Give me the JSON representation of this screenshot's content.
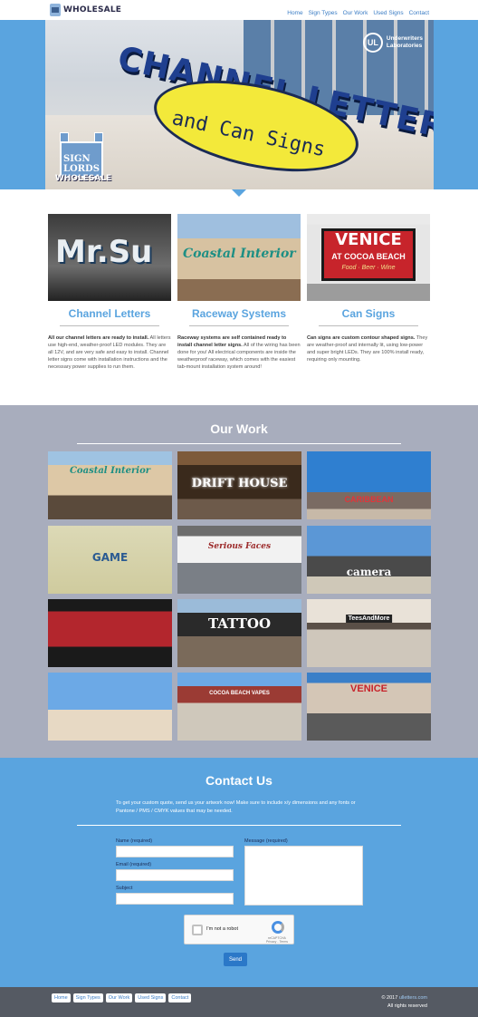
{
  "header": {
    "logo_text": "WHOLESALE",
    "nav": [
      "Home",
      "Sign Types",
      "Our Work",
      "Used Signs",
      "Contact"
    ]
  },
  "hero": {
    "headline_top": "CHANNEL LETTERS",
    "headline_bottom": "and Can Signs",
    "ul_mark": "UL",
    "ul_label_1": "Underwriters",
    "ul_label_2": "Laboratories",
    "brand_top": "SIGN LORDS",
    "brand_bottom": "WHOLESALE"
  },
  "services": [
    {
      "title": "Channel Letters",
      "image_sign": "Mr.Su",
      "lead": "All our channel letters are ready to install.",
      "body": " All letters use high-end, weather-proof LED modules. They are all 12V, and are very safe and easy to install. Channel letter signs come with installation instructions and the necessary power supplies to run them."
    },
    {
      "title": "Raceway Systems",
      "image_sign": "Coastal Interior",
      "lead": "Raceway systems are self contained ready to install channel letter signs.",
      "body": " All of the wiring has been done for you! All electrical components are inside the weatherproof raceway, which comes with the easiest tab-mount installation system around!"
    },
    {
      "title": "Can Signs",
      "image_sign": "VENICE",
      "image_sign_2": "AT COCOA BEACH",
      "image_sign_3": "Food · Beer · Wine",
      "lead": "Can signs are custom contour shaped signs.",
      "body": " They are weather-proof and internally lit, using low-power and super bright LEDs.  They are 100% install ready, requiring only mounting."
    }
  ],
  "our_work": {
    "title": "Our Work",
    "tiles": [
      {
        "sign": "Coastal Interior"
      },
      {
        "sign": "DRIFT HOUSE"
      },
      {
        "sign": "CARIBBEAN"
      },
      {
        "sign": "GAME"
      },
      {
        "sign": "Serious Faces"
      },
      {
        "sign": "camera"
      },
      {
        "sign": ""
      },
      {
        "sign": "TATTOO"
      },
      {
        "sign": "TeesAndMore"
      },
      {
        "sign": ""
      },
      {
        "sign": "COCOA BEACH VAPES"
      },
      {
        "sign": "VENICE"
      }
    ]
  },
  "contact": {
    "title": "Contact Us",
    "intro": "To get your custom quote, send us your artwork now! Make sure to include x/y dimensions and any fonts or Pantone / PMS / CMYK values that may be needed.",
    "name_label": "Name (required)",
    "email_label": "Email (required)",
    "subject_label": "Subject",
    "message_label": "Message (required)",
    "captcha_label": "I'm not a robot",
    "captcha_brand": "reCAPTCHA",
    "captcha_links": "Privacy - Terms",
    "send_label": "Send"
  },
  "footer": {
    "nav": [
      "Home",
      "Sign Types",
      "Our Work",
      "Used Signs",
      "Contact"
    ],
    "copyright_prefix": "© 2017 ",
    "copyright_link": "ulletters.com",
    "rights": "All rights reserved"
  },
  "colors": {
    "accent_blue": "#5aa4df",
    "work_bg": "#a8adbd",
    "footer_bg": "#555a63",
    "button_blue": "#2b78c8"
  }
}
